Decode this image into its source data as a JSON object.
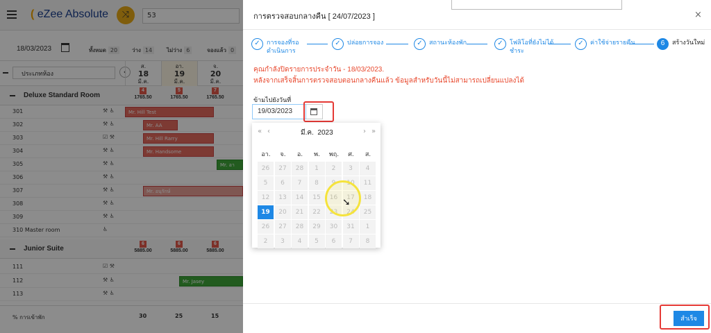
{
  "app": {
    "logo_text": "eZee Absolute",
    "search_value": "53"
  },
  "filter": {
    "date": "18/03/2023",
    "stats": [
      {
        "label": "ทั้งหมด",
        "count": "20"
      },
      {
        "label": "ว่าง",
        "count": "14"
      },
      {
        "label": "ไม่ว่าง",
        "count": "6"
      },
      {
        "label": "จองแล้ว",
        "count": "0"
      }
    ]
  },
  "grid": {
    "room_type_select": "ประเภทห้อง",
    "days": [
      {
        "wd": "ส.",
        "n": "18",
        "m": "มี.ค."
      },
      {
        "wd": "อา.",
        "n": "19",
        "m": "มี.ค."
      },
      {
        "wd": "จ.",
        "n": "20",
        "m": "มี.ค."
      }
    ],
    "groups": [
      {
        "name": "Deluxe Standard Room",
        "avail": [
          "4",
          "5",
          "7"
        ],
        "rate": [
          "1765.50",
          "1765.50",
          "1765.50"
        ]
      },
      {
        "name": "Junior Suite",
        "avail": [
          "6",
          "6",
          "6"
        ],
        "rate": [
          "5885.00",
          "5885.00",
          "5885.00"
        ]
      }
    ],
    "rooms1": [
      "301",
      "302",
      "303",
      "304",
      "305",
      "306",
      "307",
      "308",
      "309",
      "310 Master room"
    ],
    "rooms2": [
      "111",
      "112",
      "113"
    ],
    "bookings": [
      "Mr. Hill Test",
      "Mr. AA",
      "Mr. Hill Rarry",
      "Mr. Handsome",
      "Mr. อา",
      "Mr. อนุรักษ์",
      "Mr. Jasey"
    ],
    "footer_label": "% การเข้าพัก",
    "footer_values": [
      "30",
      "25",
      "15"
    ]
  },
  "panel": {
    "title": "การตรวจสอบกลางคืน [ 24/07/2023 ]",
    "close": "×",
    "steps": [
      {
        "label": "การจองที่รอดำเนินการ",
        "icon": "check-icon"
      },
      {
        "label": "ปล่อยการจอง",
        "icon": "check-icon"
      },
      {
        "label": "สถานะห้องพัก",
        "icon": "check-icon"
      },
      {
        "label": "โฟลิโอที่ยังไม่ได้ชำระ",
        "icon": "check-icon"
      },
      {
        "label": "ค่าใช้จ่ายรายคืน",
        "icon": "check-icon"
      },
      {
        "label": "สร้างวันใหม่",
        "num": "6"
      }
    ],
    "warning_line1": "คุณกำลังปิดรายการประจำวัน - 18/03/2023.",
    "warning_line2": "หลังจากเสร็จสิ้นการตรวจสอบตอนกลางคืนแล้ว ข้อมูลสำหรับวันนี้ไม่สามารถเปลี่ยนแปลงได้",
    "skip_label": "ข้ามไปยังวันที่",
    "date_value": "19/03/2023",
    "done_button": "สำเร็จ",
    "accent": "#1e88e5",
    "warn_color": "#e8472c"
  },
  "datepicker": {
    "month_label": "มี.ค.",
    "year_label": "2023",
    "nav_prev_year": "«",
    "nav_prev": "‹",
    "nav_next": "›",
    "nav_next_year": "»",
    "weekdays": [
      "อา.",
      "จ.",
      "อ.",
      "พ.",
      "พฤ.",
      "ศ.",
      "ส."
    ],
    "weeks": [
      [
        "26",
        "27",
        "28",
        "1",
        "2",
        "3",
        "4"
      ],
      [
        "5",
        "6",
        "7",
        "8",
        "9",
        "10",
        "11"
      ],
      [
        "12",
        "13",
        "14",
        "15",
        "16",
        "17",
        "18"
      ],
      [
        "19",
        "20",
        "21",
        "22",
        "23",
        "24",
        "25"
      ],
      [
        "26",
        "27",
        "28",
        "29",
        "30",
        "31",
        "1"
      ],
      [
        "2",
        "3",
        "4",
        "5",
        "6",
        "7",
        "8"
      ]
    ],
    "selected": "19"
  }
}
